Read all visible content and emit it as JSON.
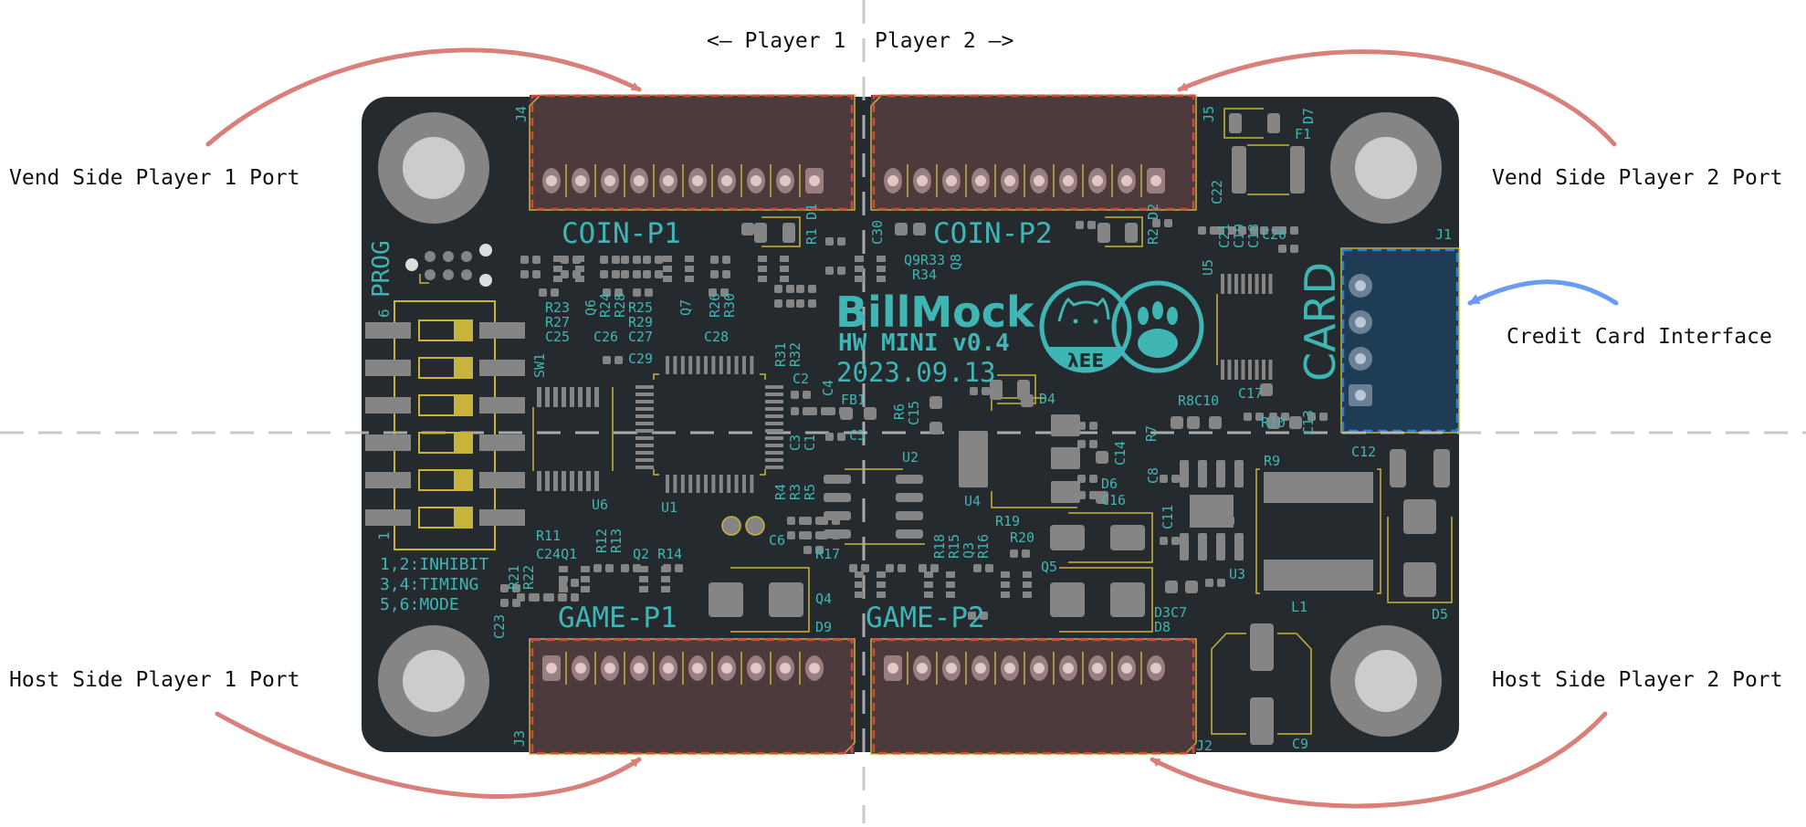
{
  "header": {
    "player1_label": "<– Player 1",
    "player2_label": "Player 2 –>"
  },
  "callouts": {
    "vend_p1": "Vend Side Player 1 Port",
    "vend_p2": "Vend Side Player 2 Port",
    "credit_card": "Credit Card Interface",
    "host_p1": "Host Side Player 1 Port",
    "host_p2": "Host Side Player 2 Port"
  },
  "colors": {
    "board": "#242a2e",
    "connector_body": "#4d3a3d",
    "card_connector_body": "#1f3c55",
    "silkscreen": "#3fb6b4",
    "outline_yellow": "#c8b43c",
    "courtyard_red": "#d2483c",
    "pad_gray": "#858585",
    "arrow_red": "#d9807a",
    "arrow_blue": "#6a9cf6",
    "divider_gray": "#c0c0c0"
  },
  "board": {
    "title": "BillMock",
    "subtitle": "HW MINI v0.4",
    "date": "2023.09.13",
    "logo_text": "λEE",
    "card_label": "CARD",
    "prog_label": "PROG",
    "dip_legend": [
      "1,2:INHIBIT",
      "3,4:TIMING",
      "5,6:MODE"
    ],
    "dip_pin_top": "6",
    "dip_pin_bottom": "1",
    "connectors": {
      "coin_p1": {
        "ref": "J4",
        "label": "COIN-P1",
        "pins": 10
      },
      "coin_p2": {
        "ref": "J5",
        "label": "COIN-P2",
        "pins": 10
      },
      "game_p1": {
        "ref": "J3",
        "label": "GAME-P1",
        "pins": 10
      },
      "game_p2": {
        "ref": "J2",
        "label": "GAME-P2",
        "pins": 10
      },
      "card": {
        "ref": "J1",
        "pins": 4
      }
    },
    "refdes": {
      "sw1": "SW1",
      "u1": "U1",
      "u2": "U2",
      "u3": "U3",
      "u4": "U4",
      "u5": "U5",
      "u6": "U6",
      "r1d1": "R1 D1",
      "r2d2": "R2 D2",
      "c30": "C30",
      "c22": "C22",
      "d7": "D7",
      "f1": "F1",
      "q9r33": "Q9R33",
      "q8": "Q8",
      "r34": "R34",
      "c21": "C21",
      "c19": "C19",
      "c18": "C18",
      "c20": "C20",
      "r23": "R23",
      "r27": "R27",
      "c25": "C25",
      "q6": "Q6",
      "r24": "R24",
      "r28": "R28",
      "c26": "C26",
      "r25": "R25",
      "r29": "R29",
      "c27": "C27",
      "q7": "Q7",
      "r26": "R26",
      "r30": "R30",
      "c28": "C28",
      "c29": "C29",
      "r31": "R31",
      "r32": "R32",
      "c2": "C2",
      "c4": "C4",
      "c3": "C3",
      "c1": "C1",
      "fb1": "FB1",
      "c5": "C5",
      "r6": "R6",
      "c15": "C15",
      "d4": "D4",
      "r8c10": "R8C10",
      "c17": "C17",
      "r7": "R7",
      "r10": "R10",
      "c13": "C13",
      "c14": "C14",
      "d6": "D6",
      "c16": "C16",
      "c8": "C8",
      "c11": "C11",
      "r9": "R9",
      "c12": "C12",
      "r4": "R4",
      "r3": "R3",
      "r5": "R5",
      "c6": "C6",
      "r19": "R19",
      "r20": "R20",
      "r18": "R18",
      "r15": "R15",
      "q3": "Q3",
      "r16": "R16",
      "r17": "R17",
      "q4": "Q4",
      "q5": "Q5",
      "d9": "D9",
      "d3c7": "D3C7",
      "d8": "D8",
      "l1": "L1",
      "d5": "D5",
      "c9": "C9",
      "r11": "R11",
      "c24q1": "C24Q1",
      "r12": "R12",
      "r13": "R13",
      "q2r14": "Q2 R14",
      "r21": "R21",
      "r22": "R22",
      "c23": "C23",
      "j1": "J1"
    }
  }
}
